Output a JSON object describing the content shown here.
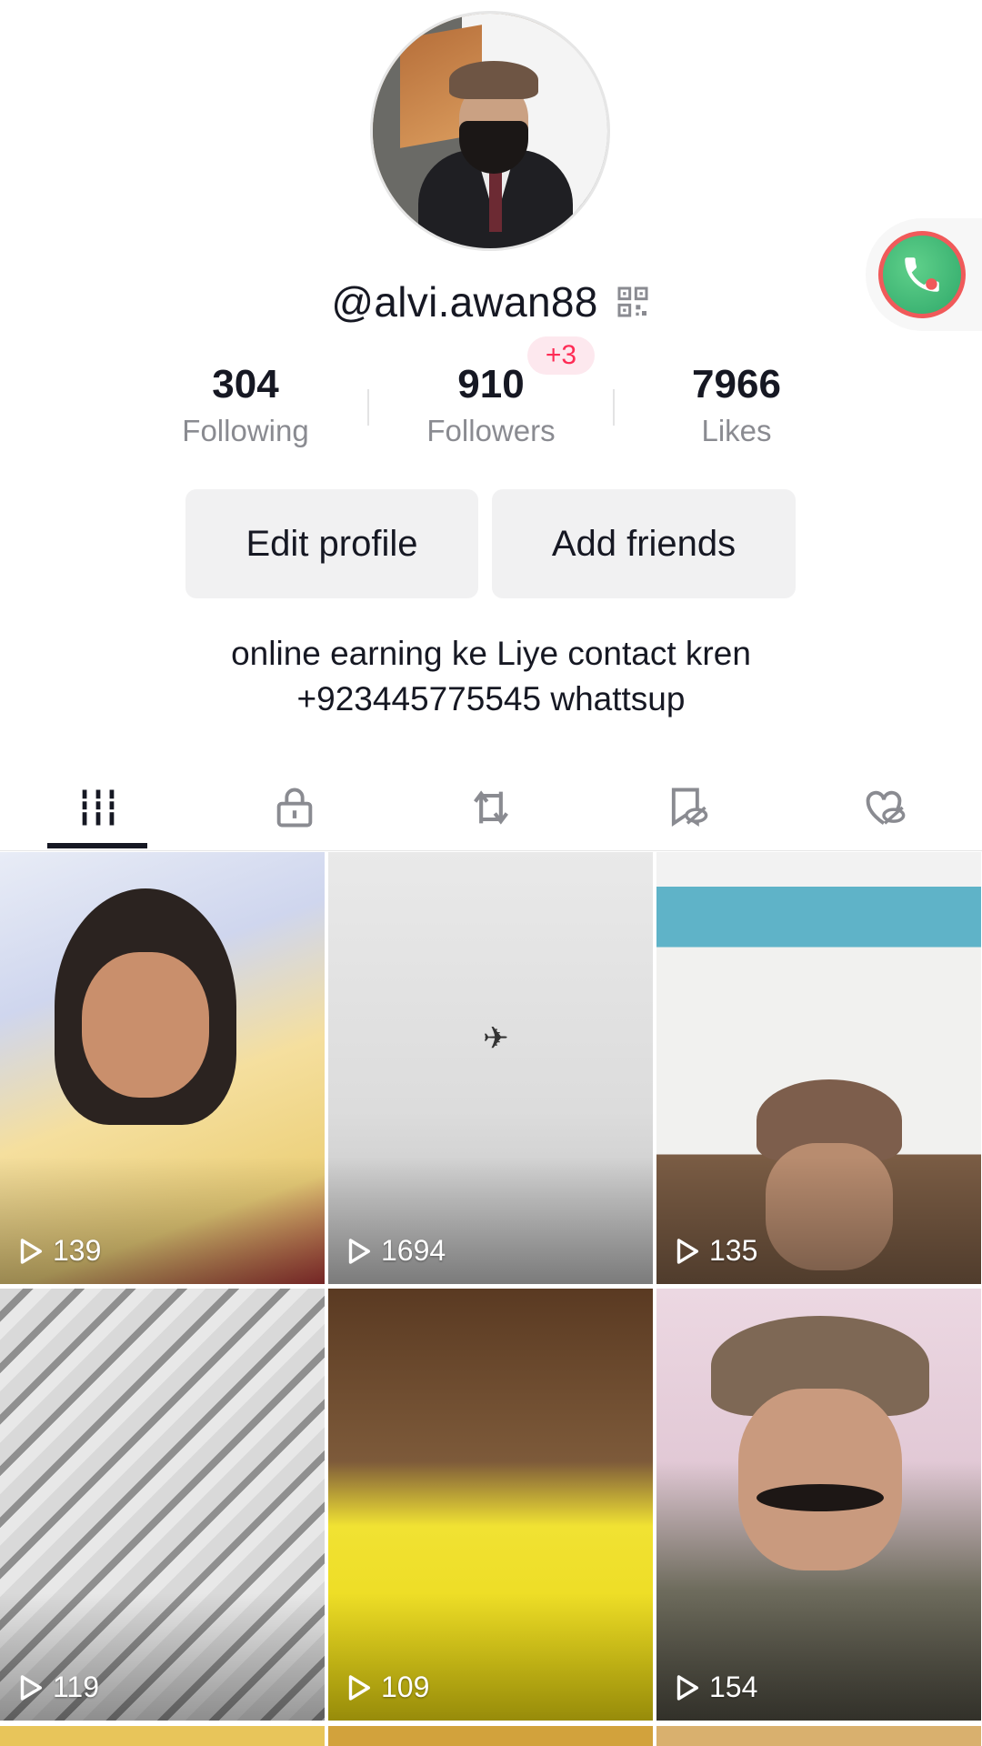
{
  "profile": {
    "username": "@alvi.awan88",
    "bio_line1": "online earning ke Liye contact kren",
    "bio_line2": "+923445775545 whattsup"
  },
  "stats": {
    "following": {
      "value": "304",
      "label": "Following"
    },
    "followers": {
      "value": "910",
      "label": "Followers",
      "badge": "+3"
    },
    "likes": {
      "value": "7966",
      "label": "Likes"
    }
  },
  "actions": {
    "edit_profile": "Edit profile",
    "add_friends": "Add friends"
  },
  "tabs": [
    {
      "name": "videos",
      "icon": "grid-bars-icon",
      "active": true
    },
    {
      "name": "private",
      "icon": "lock-icon",
      "active": false
    },
    {
      "name": "reposts",
      "icon": "repost-icon",
      "active": false
    },
    {
      "name": "favorites",
      "icon": "bookmark-hidden-icon",
      "active": false
    },
    {
      "name": "liked",
      "icon": "heart-hidden-icon",
      "active": false
    }
  ],
  "videos": [
    {
      "views": "139"
    },
    {
      "views": "1694"
    },
    {
      "views": "135"
    },
    {
      "views": "119"
    },
    {
      "views": "109"
    },
    {
      "views": "154"
    }
  ],
  "colors": {
    "accent": "#fe2c55",
    "text_primary": "#161823",
    "text_secondary": "#8a8b91",
    "button_bg": "#f1f1f2"
  }
}
